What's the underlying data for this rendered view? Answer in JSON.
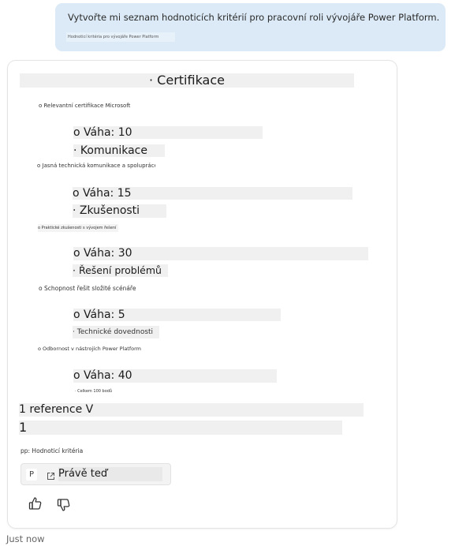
{
  "user_message": {
    "text": "Vytvořte mi seznam hodnoticích kritérií pro pracovní roli vývojáře Power Platform.",
    "subtext": "Hodnoticí kritéria pro vývojáře Power Platform"
  },
  "response": {
    "criteria": [
      {
        "name": "· Certifikace",
        "description": "o Relevantní certifikace Microsoft",
        "weight": "o Váha: 10"
      },
      {
        "name": "· Komunikace",
        "description": "o Jasná technická komunikace a spolupráce",
        "weight": "o Váha: 15"
      },
      {
        "name": "· Zkušenosti",
        "description": "o Praktické zkušenosti s vývojem řešení",
        "weight": "o Váha: 30"
      },
      {
        "name": "· Řešení problémů",
        "description": "o Schopnost řešit složité scénáře",
        "weight": "o Váha: 5"
      },
      {
        "name": "· Technické dovednosti",
        "description": "o Odbornost v nástrojích Power Platform",
        "weight": "o Váha: 40"
      }
    ],
    "trailing_note": "· Celkem 100 bodů",
    "references_header": "1 reference V",
    "references_count": "1",
    "reference_caption": "pp: Hodnoticí kritéria",
    "reference_button": {
      "badge": "P",
      "icon": "external-link-icon",
      "label": "Právě teď"
    }
  },
  "feedback": {
    "like_icon": "thumbs-up-icon",
    "dislike_icon": "thumbs-down-icon"
  },
  "timestamp": "Just now"
}
